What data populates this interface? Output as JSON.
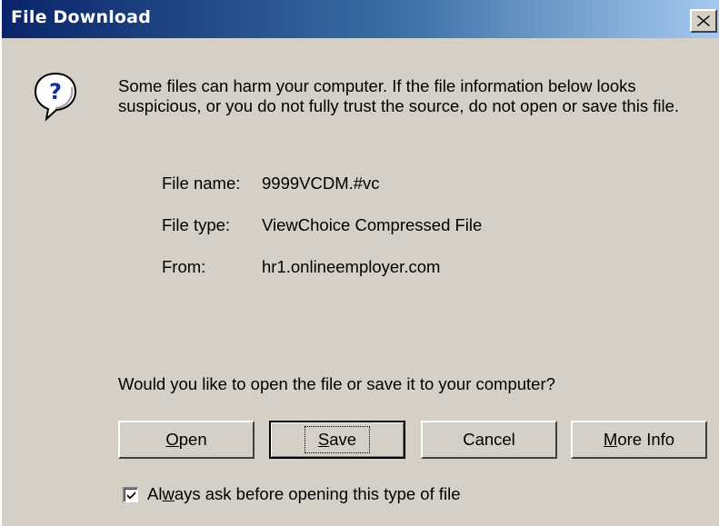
{
  "window": {
    "title": "File Download"
  },
  "message": {
    "warning": "Some files can harm your computer. If the file information below looks suspicious, or you do not fully trust the source, do not open or save this file."
  },
  "file_info": {
    "name_label": "File name:",
    "name_value": "9999VCDM.#vc",
    "type_label": "File type:",
    "type_value": "ViewChoice Compressed File",
    "from_label": "From:",
    "from_value": "hr1.onlineemployer.com"
  },
  "prompt": {
    "question": "Would you like to open the file or save it to your computer?"
  },
  "buttons": {
    "open": {
      "mnemonic": "O",
      "rest": "pen"
    },
    "save": {
      "mnemonic": "S",
      "rest": "ave"
    },
    "cancel": "Cancel",
    "more_info": {
      "mnemonic": "M",
      "rest": "ore Info"
    }
  },
  "checkbox": {
    "checked": true,
    "label_pre": "Al",
    "label_mnemonic": "w",
    "label_post": "ays ask before opening this type of file"
  },
  "icons": {
    "help": "question-bubble-icon",
    "close": "close-icon",
    "check": "checkmark-icon"
  },
  "colors": {
    "dialog_bg": "#d4d0c8",
    "titlebar_start": "#0a246a",
    "titlebar_end": "#a6caf0",
    "help_icon_blue": "#1030a0"
  }
}
